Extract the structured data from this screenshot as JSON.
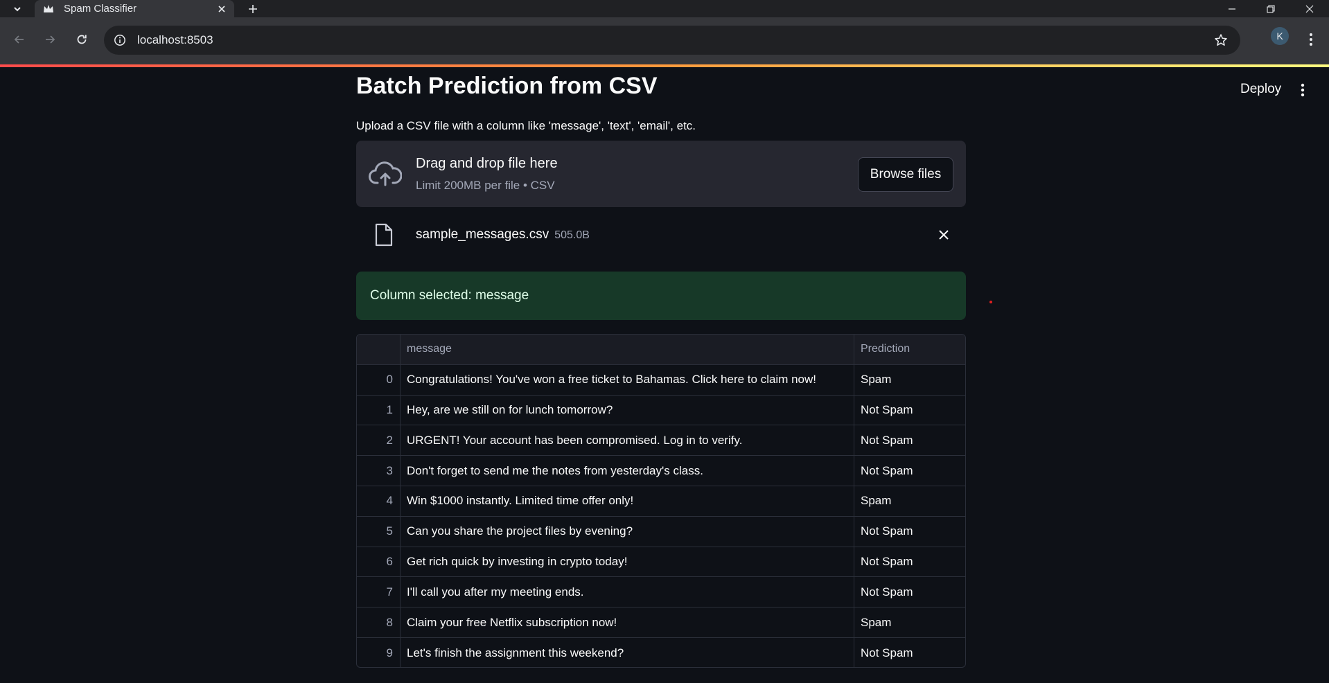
{
  "browser": {
    "tab_title": "Spam Classifier",
    "url": "localhost:8503",
    "profile_initial": "K"
  },
  "app": {
    "deploy_label": "Deploy",
    "title": "Batch Prediction from CSV",
    "caption": "Upload a CSV file with a column like 'message', 'text', 'email', etc.",
    "uploader": {
      "drop_title": "Drag and drop file here",
      "drop_sub": "Limit 200MB per file • CSV",
      "browse_label": "Browse files"
    },
    "file": {
      "name": "sample_messages.csv",
      "size": "505.0B"
    },
    "success_message": "Column selected: message",
    "table": {
      "columns": [
        "",
        "message",
        "Prediction"
      ],
      "rows": [
        {
          "idx": "0",
          "message": "Congratulations! You've won a free ticket to Bahamas. Click here to claim now!",
          "prediction": "Spam"
        },
        {
          "idx": "1",
          "message": "Hey, are we still on for lunch tomorrow?",
          "prediction": "Not Spam"
        },
        {
          "idx": "2",
          "message": "URGENT! Your account has been compromised. Log in to verify.",
          "prediction": "Not Spam"
        },
        {
          "idx": "3",
          "message": "Don't forget to send me the notes from yesterday's class.",
          "prediction": "Not Spam"
        },
        {
          "idx": "4",
          "message": "Win $1000 instantly. Limited time offer only!",
          "prediction": "Spam"
        },
        {
          "idx": "5",
          "message": "Can you share the project files by evening?",
          "prediction": "Not Spam"
        },
        {
          "idx": "6",
          "message": "Get rich quick by investing in crypto today!",
          "prediction": "Not Spam"
        },
        {
          "idx": "7",
          "message": "I'll call you after my meeting ends.",
          "prediction": "Not Spam"
        },
        {
          "idx": "8",
          "message": "Claim your free Netflix subscription now!",
          "prediction": "Spam"
        },
        {
          "idx": "9",
          "message": "Let's finish the assignment this weekend?",
          "prediction": "Not Spam"
        }
      ]
    }
  }
}
